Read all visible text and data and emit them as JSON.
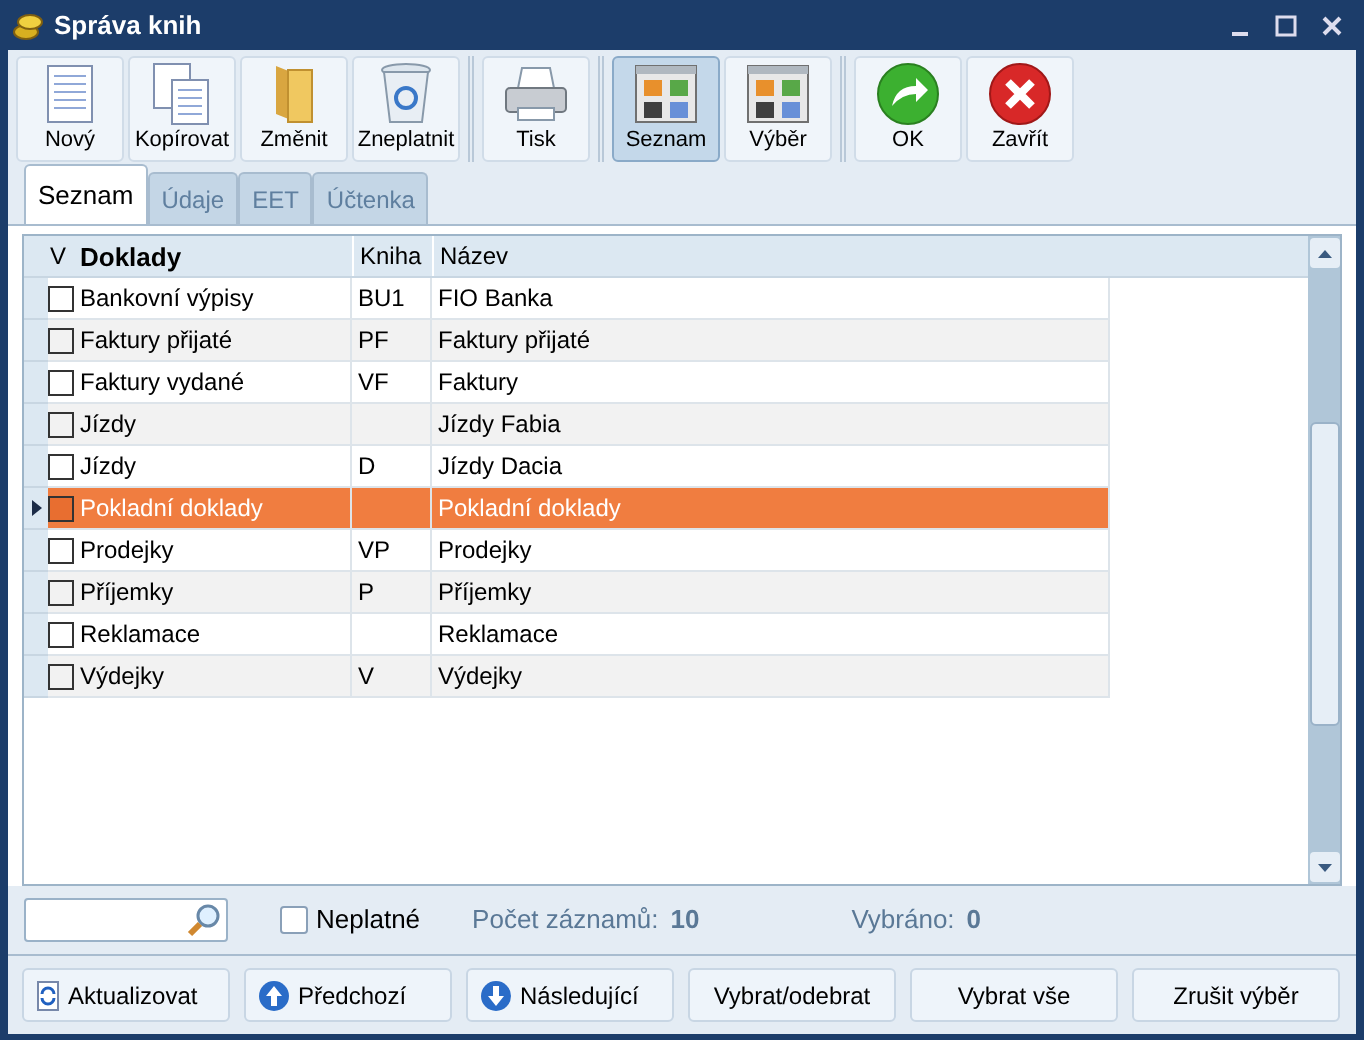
{
  "window": {
    "title": "Správa knih"
  },
  "toolbar": [
    {
      "label": "Nový",
      "kind": "new",
      "selected": false,
      "separator_before": false
    },
    {
      "label": "Kopírovat",
      "kind": "copy",
      "selected": false,
      "separator_before": false
    },
    {
      "label": "Změnit",
      "kind": "folder",
      "selected": false,
      "separator_before": false
    },
    {
      "label": "Zneplatnit",
      "kind": "bin",
      "selected": false,
      "separator_before": false
    },
    {
      "label": "Tisk",
      "kind": "printer",
      "selected": false,
      "separator_before": true
    },
    {
      "label": "Seznam",
      "kind": "grid",
      "selected": true,
      "separator_before": true
    },
    {
      "label": "Výběr",
      "kind": "grid",
      "selected": false,
      "separator_before": false
    },
    {
      "label": "OK",
      "kind": "ok",
      "selected": false,
      "separator_before": true
    },
    {
      "label": "Zavřít",
      "kind": "close",
      "selected": false,
      "separator_before": false
    }
  ],
  "tabs": [
    {
      "label": "Seznam",
      "selected": true
    },
    {
      "label": "Údaje",
      "selected": false
    },
    {
      "label": "EET",
      "selected": false
    },
    {
      "label": "Účtenka",
      "selected": false
    }
  ],
  "table": {
    "columns": [
      "V",
      "Doklady",
      "Kniha",
      "Název"
    ],
    "rows": [
      {
        "checked": false,
        "selected": false,
        "doklady": "Bankovní výpisy",
        "kniha": "BU1",
        "nazev": "FIO Banka"
      },
      {
        "checked": false,
        "selected": false,
        "doklady": "Faktury přijaté",
        "kniha": "PF",
        "nazev": "Faktury přijaté"
      },
      {
        "checked": false,
        "selected": false,
        "doklady": "Faktury vydané",
        "kniha": "VF",
        "nazev": "Faktury"
      },
      {
        "checked": false,
        "selected": false,
        "doklady": "Jízdy",
        "kniha": "",
        "nazev": "Jízdy Fabia"
      },
      {
        "checked": false,
        "selected": false,
        "doklady": "Jízdy",
        "kniha": "D",
        "nazev": "Jízdy Dacia"
      },
      {
        "checked": false,
        "selected": true,
        "doklady": "Pokladní doklady",
        "kniha": "",
        "nazev": "Pokladní doklady"
      },
      {
        "checked": false,
        "selected": false,
        "doklady": "Prodejky",
        "kniha": "VP",
        "nazev": "Prodejky"
      },
      {
        "checked": false,
        "selected": false,
        "doklady": "Příjemky",
        "kniha": "P",
        "nazev": "Příjemky"
      },
      {
        "checked": false,
        "selected": false,
        "doklady": "Reklamace",
        "kniha": "",
        "nazev": "Reklamace"
      },
      {
        "checked": false,
        "selected": false,
        "doklady": "Výdejky",
        "kniha": "V",
        "nazev": "Výdejky"
      }
    ]
  },
  "status": {
    "invalid": {
      "label": "Neplatné",
      "checked": false
    },
    "count_label": "Počet záznamů:",
    "count": "10",
    "selected_label": "Vybráno:",
    "selected_count": "0"
  },
  "buttons": [
    {
      "label": "Aktualizovat",
      "kind": "refresh"
    },
    {
      "label": "Předchozí",
      "kind": "up"
    },
    {
      "label": "Následující",
      "kind": "down"
    },
    {
      "label": "Vybrat/odebrat",
      "kind": "plain"
    },
    {
      "label": "Vybrat vše",
      "kind": "plain"
    },
    {
      "label": "Zrušit výběr",
      "kind": "plain"
    }
  ]
}
